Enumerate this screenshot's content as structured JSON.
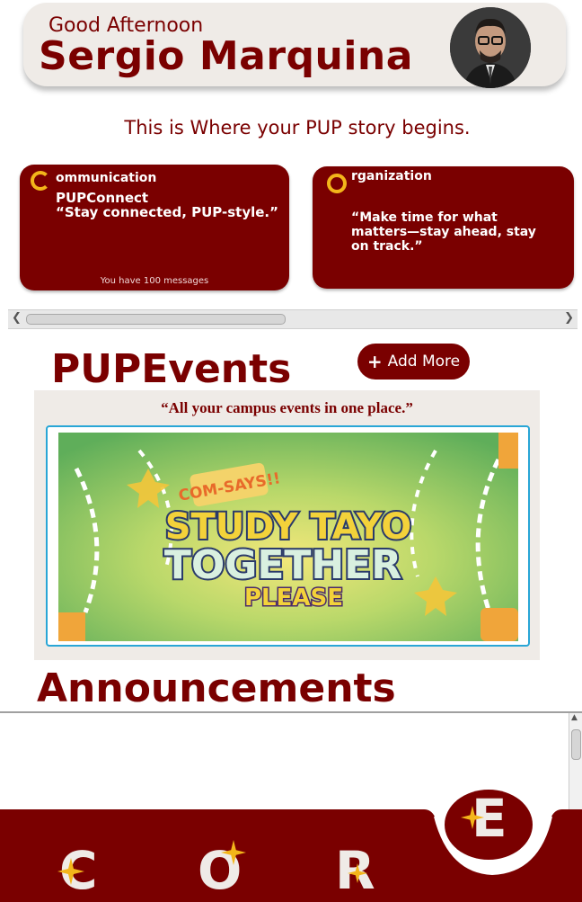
{
  "header": {
    "greeting": "Good Afternoon",
    "user_name": "Sergio Marquina"
  },
  "tagline": "This is Where your PUP story begins.",
  "cards": {
    "communication": {
      "letter": "C",
      "title": "ommunication",
      "subtitle": "PUPConnect",
      "quote": "“Stay connected, PUP-style.”",
      "footer": "You have 100 messages"
    },
    "organization": {
      "letter": "O",
      "title": "rganization",
      "quote": "“Make time for what matters—stay ahead, stay on track.”"
    }
  },
  "events": {
    "heading": "PUPEvents",
    "add_button": "Add More",
    "quote": "“All your campus events in one place.”",
    "banner": {
      "line1": "COM-SAYS!!",
      "line2": "STUDY TAYO",
      "line3": "TOGETHER",
      "line4": "PLEASE"
    }
  },
  "announcements": {
    "heading": "Announcements"
  },
  "bottom_nav": {
    "items": [
      "C",
      "O",
      "R",
      "E"
    ]
  },
  "colors": {
    "brand": "#7a0000",
    "card_bg": "#efebe7",
    "accent_gold": "#f3b51a",
    "frame_blue": "#29a6d6"
  }
}
